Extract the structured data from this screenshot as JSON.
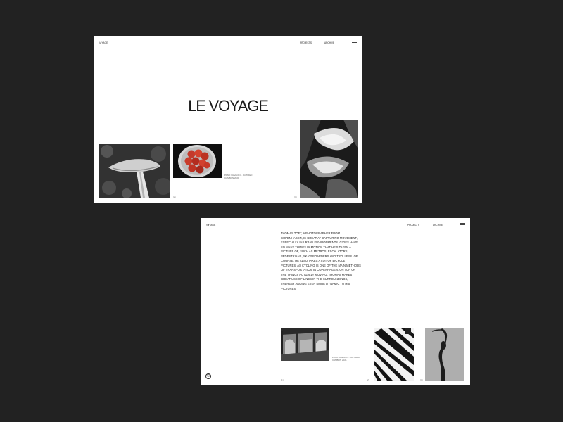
{
  "logo": "VøYAGE",
  "nav": {
    "projects": "PROJECTS",
    "archive": "ARCHIVE"
  },
  "page1": {
    "title": "LE VOYAGE",
    "caption": "PANO WAVACIN… ACTIRED CAMBON 2021",
    "numbers": [
      "(2)",
      "(3)"
    ]
  },
  "page2": {
    "paragraph": "THOMAS TOFT, A PHOTOGRAPHER FROM COPENHAGEN, IS GREAT AT CAPTURING MOVEMENT, ESPECIALLY IN URBAN ENVIRONMENTS. CITIES HAVE SO MANY THINGS IN MOTION THAT HE'S TAKEN A PICTURE OF, SUCH AS METROS, ESCALATORS, PEDESTRIANS, SKATEBOARDERS AND TROLLEYS. OF COURSE, HE ALSO TAKES A LOT OF BICYCLE PICTURES, AS CYCLING IS ONE OF THE MAIN METHODS OF TRANSPORTATION IN COPENHAGEN. ON TOP OF THE THINGS ACTUALLY MOVING, THOMAS MAKES GREAT USE OF LINES IN THE SURROUNDINGS, THEREBY ADDING EVEN MORE DYNAMIC TO HIS PICTURES.",
    "caption": "PANO WAVACIN… ACTIRED CAMBON 2021",
    "numbers": [
      "(1)",
      "(2)",
      "(3)"
    ],
    "copyright": "©"
  },
  "icons": {
    "menu": "hamburger-menu-icon",
    "copyright": "copyright-icon"
  },
  "colors": {
    "background": "#222222",
    "card": "#ffffff",
    "text": "#1a1a1a"
  }
}
